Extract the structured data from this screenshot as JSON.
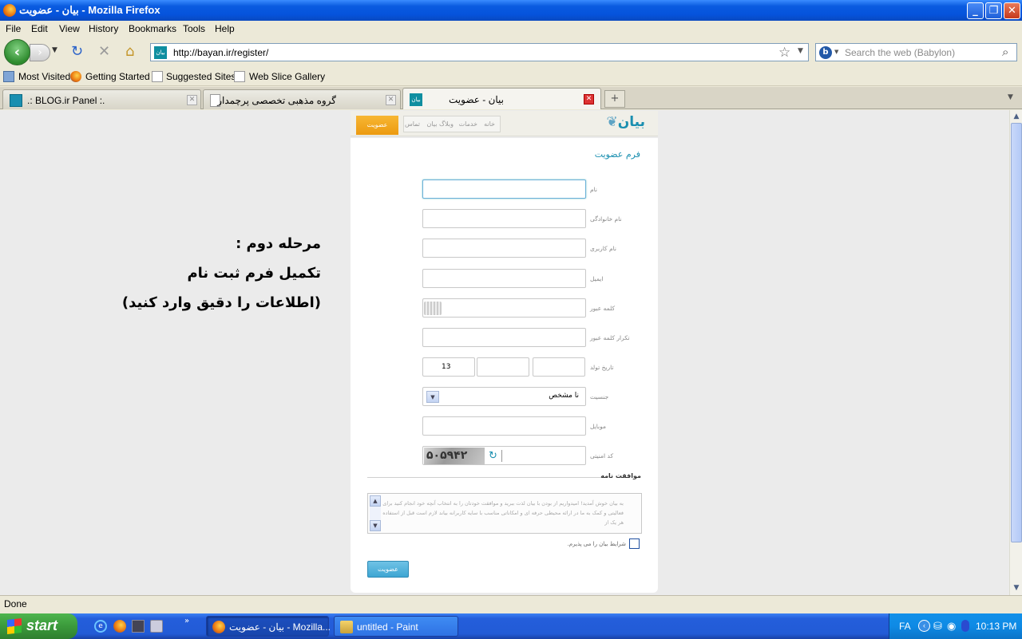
{
  "window": {
    "title": "بیان - عضویت - Mozilla Firefox"
  },
  "menu": [
    "File",
    "Edit",
    "View",
    "History",
    "Bookmarks",
    "Tools",
    "Help"
  ],
  "nav": {
    "url": "http://bayan.ir/register/",
    "site_icon_text": "بیان",
    "search_placeholder": "Search the web (Babylon)"
  },
  "bookmarks": [
    "Most Visited",
    "Getting Started",
    "Suggested Sites",
    "Web Slice Gallery"
  ],
  "tabs": [
    {
      "label": ".: BLOG.ir Panel :."
    },
    {
      "label": "گروه مذهبی تخصصی پرچمدار"
    },
    {
      "label": "بیان - عضویت",
      "active": true
    }
  ],
  "page": {
    "logo": "بیان",
    "topnav": [
      "خانه",
      "خدمات",
      "وبلاگ بیان",
      "تماس"
    ],
    "join_button": "عضویت",
    "form_title": "فرم عضویت",
    "fields": {
      "first_name": "نام",
      "last_name": "نام خانوادگی",
      "username": "نام کاربری",
      "email": "ایمیل",
      "password": "کلمه عبور",
      "password_repeat": "تکرار کلمه عبور",
      "birthdate": "تاریخ تولد",
      "gender": "جنسیت",
      "mobile": "موبایل",
      "captcha": "کد امنیتی"
    },
    "birth_year_value": "13",
    "gender_value": "نا مشخص",
    "captcha_text": "۵۰۵۹۴۲",
    "agreement_title": "موافقت نامه",
    "terms_text": "به بیان خوش آمدید! امیدواریم از بودن با بیان لذت ببرید و موافقت خودتان را به انتخاب آنچه خود انجام کنید برای فعالیتی و کمک به ما در ارائه محیطی حرفه ای و امکاناتی مناسب با سایه کاربرانه بیاند لازم است قبل از استفاده از هر یک از",
    "agree_label": "شرایط بیان را می پذیرم.",
    "submit": "عضویت"
  },
  "annotation": {
    "line1": "مرحله دوم :",
    "line2": "تکمیل فرم ثبت نام",
    "line3": "(اطلاعات را دقیق وارد کنید)"
  },
  "status": "Done",
  "taskbar": {
    "start": "start",
    "tasks": [
      "بیان - عضویت - Mozilla...",
      "untitled - Paint"
    ],
    "lang": "FA",
    "clock": "10:13 PM"
  }
}
